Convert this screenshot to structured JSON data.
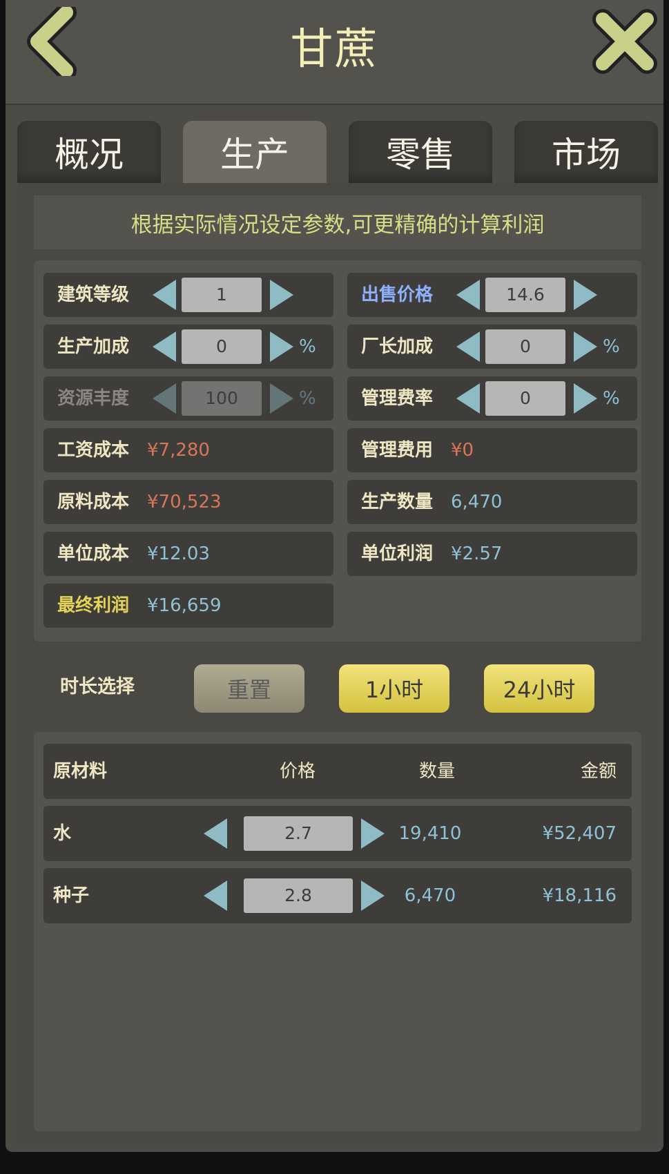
{
  "header": {
    "title": "甘蔗",
    "back_icon": "chevron-left-icon",
    "close_icon": "close-x-icon"
  },
  "tabs": [
    {
      "label": "概况",
      "active": false
    },
    {
      "label": "生产",
      "active": true
    },
    {
      "label": "零售",
      "active": false
    },
    {
      "label": "市场",
      "active": false
    }
  ],
  "notice": "根据实际情况设定参数,可更精确的计算利润",
  "params": {
    "building_level": {
      "label": "建筑等级",
      "value": "1"
    },
    "production_bonus": {
      "label": "生产加成",
      "value": "0",
      "unit": "%"
    },
    "resource_abundance": {
      "label": "资源丰度",
      "value": "100",
      "unit": "%"
    },
    "sell_price": {
      "label": "出售价格",
      "value": "14.6"
    },
    "manager_bonus": {
      "label": "厂长加成",
      "value": "0",
      "unit": "%"
    },
    "admin_rate": {
      "label": "管理费率",
      "value": "0",
      "unit": "%"
    },
    "wage_cost": {
      "label": "工资成本",
      "value": "¥7,280"
    },
    "material_cost": {
      "label": "原料成本",
      "value": "¥70,523"
    },
    "unit_cost": {
      "label": "单位成本",
      "value": "¥12.03"
    },
    "final_profit": {
      "label": "最终利润",
      "value": "¥16,659"
    },
    "admin_fee": {
      "label": "管理费用",
      "value": "¥0"
    },
    "output_qty": {
      "label": "生产数量",
      "value": "6,470"
    },
    "unit_profit": {
      "label": "单位利润",
      "value": "¥2.57"
    }
  },
  "duration": {
    "label": "时长选择",
    "reset": "重置",
    "one_hour": "1小时",
    "day": "24小时"
  },
  "materials": {
    "headers": {
      "name": "原材料",
      "price": "价格",
      "qty": "数量",
      "amount": "金额"
    },
    "rows": [
      {
        "name": "水",
        "price": "2.7",
        "qty": "19,410",
        "amount": "¥52,407"
      },
      {
        "name": "种子",
        "price": "2.8",
        "qty": "6,470",
        "amount": "¥18,116"
      }
    ]
  },
  "colors": {
    "accent_arrow": "#8fbcc4",
    "gold_button": "#e6d65a",
    "cost_red": "#d9765a",
    "value_cyan": "#8fc2d6"
  }
}
